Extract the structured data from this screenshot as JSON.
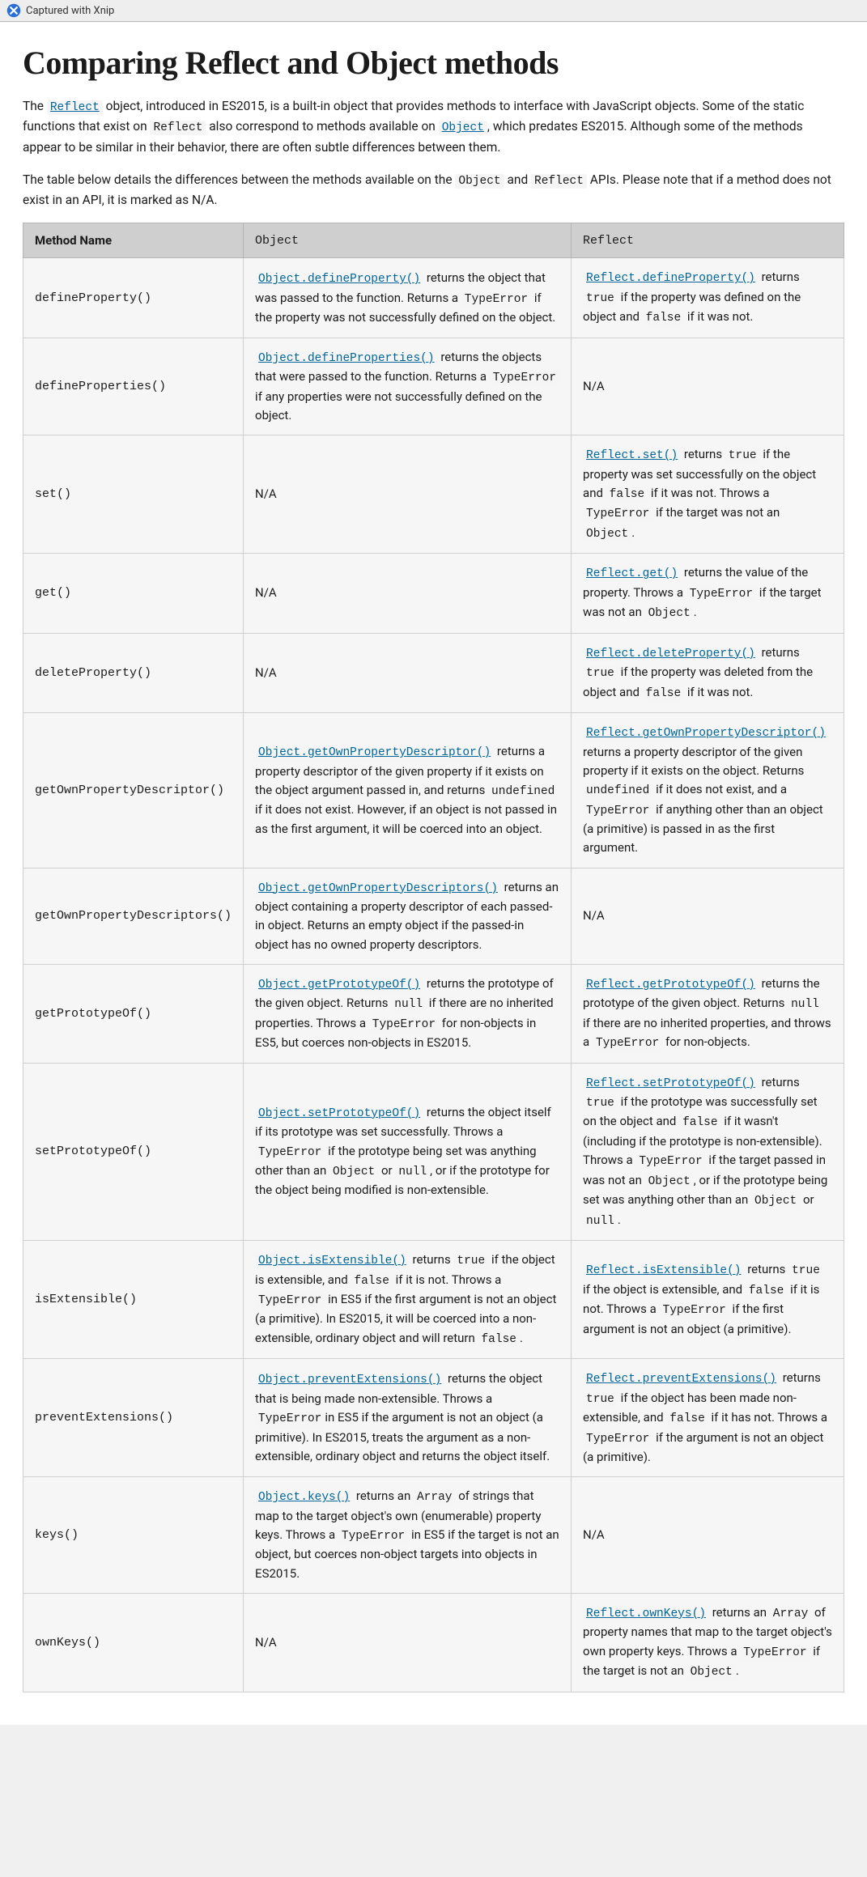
{
  "watermark": {
    "label": "Captured with Xnip"
  },
  "title": "Comparing Reflect and Object methods",
  "intro": {
    "p1_pre": "The ",
    "p1_reflect_link": "Reflect",
    "p1_mid1": " object, introduced in ES2015, is a built-in object that provides methods to interface with JavaScript objects. Some of the static functions that exist on ",
    "p1_reflect_code": "Reflect",
    "p1_mid2": " also correspond to methods available on ",
    "p1_object_link": "Object",
    "p1_tail": ", which predates ES2015. Although some of the methods appear to be similar in their behavior, there are often subtle differences between them.",
    "p2_pre": "The table below details the differences between the methods available on the ",
    "p2_object_code": "Object",
    "p2_and": " and ",
    "p2_reflect_code": "Reflect",
    "p2_tail": " APIs. Please note that if a method does not exist in an API, it is marked as N/A."
  },
  "table": {
    "headers": {
      "name": "Method Name",
      "object": "Object",
      "reflect": "Reflect"
    },
    "na": "N/A",
    "rows": [
      {
        "method": "defineProperty()",
        "object": {
          "segments": [
            {
              "t": "link",
              "v": "Object.defineProperty()"
            },
            {
              "t": "text",
              "v": " returns the object that was passed to the function. Returns a "
            },
            {
              "t": "code",
              "v": "TypeError"
            },
            {
              "t": "text",
              "v": " if the property was not successfully defined on the object."
            }
          ]
        },
        "reflect": {
          "segments": [
            {
              "t": "link",
              "v": "Reflect.defineProperty()"
            },
            {
              "t": "text",
              "v": " returns "
            },
            {
              "t": "code",
              "v": "true"
            },
            {
              "t": "text",
              "v": " if the property was defined on the object and "
            },
            {
              "t": "code",
              "v": "false"
            },
            {
              "t": "text",
              "v": " if it was not."
            }
          ]
        }
      },
      {
        "method": "defineProperties()",
        "object": {
          "segments": [
            {
              "t": "link",
              "v": "Object.defineProperties()"
            },
            {
              "t": "text",
              "v": " returns the objects that were passed to the function. Returns a "
            },
            {
              "t": "code",
              "v": "TypeError"
            },
            {
              "t": "text",
              "v": " if any properties were not successfully defined on the object."
            }
          ]
        },
        "reflect": {
          "na": true
        }
      },
      {
        "method": "set()",
        "object": {
          "na": true
        },
        "reflect": {
          "segments": [
            {
              "t": "link",
              "v": "Reflect.set()"
            },
            {
              "t": "text",
              "v": " returns "
            },
            {
              "t": "code",
              "v": "true"
            },
            {
              "t": "text",
              "v": " if the property was set successfully on the object and "
            },
            {
              "t": "code",
              "v": "false"
            },
            {
              "t": "text",
              "v": " if it was not. Throws a "
            },
            {
              "t": "code",
              "v": "TypeError"
            },
            {
              "t": "text",
              "v": " if the target was not an "
            },
            {
              "t": "code",
              "v": "Object"
            },
            {
              "t": "text",
              "v": "."
            }
          ]
        }
      },
      {
        "method": "get()",
        "object": {
          "na": true
        },
        "reflect": {
          "segments": [
            {
              "t": "link",
              "v": "Reflect.get()"
            },
            {
              "t": "text",
              "v": " returns the value of the property. Throws a "
            },
            {
              "t": "code",
              "v": "TypeError"
            },
            {
              "t": "text",
              "v": " if the target was not an "
            },
            {
              "t": "code",
              "v": "Object"
            },
            {
              "t": "text",
              "v": "."
            }
          ]
        }
      },
      {
        "method": "deleteProperty()",
        "object": {
          "na": true
        },
        "reflect": {
          "segments": [
            {
              "t": "link",
              "v": "Reflect.deleteProperty()"
            },
            {
              "t": "text",
              "v": " returns "
            },
            {
              "t": "code",
              "v": "true"
            },
            {
              "t": "text",
              "v": " if the property was deleted from the object and "
            },
            {
              "t": "code",
              "v": "false"
            },
            {
              "t": "text",
              "v": " if it was not."
            }
          ]
        }
      },
      {
        "method": "getOwnPropertyDescriptor()",
        "object": {
          "segments": [
            {
              "t": "link",
              "v": "Object.getOwnPropertyDescriptor()"
            },
            {
              "t": "text",
              "v": " returns a property descriptor of the given property if it exists on the object argument passed in, and returns "
            },
            {
              "t": "code",
              "v": "undefined"
            },
            {
              "t": "text",
              "v": " if it does not exist. However, if an object is not passed in as the first argument, it will be coerced into an object."
            }
          ]
        },
        "reflect": {
          "segments": [
            {
              "t": "link",
              "v": "Reflect.getOwnPropertyDescriptor()"
            },
            {
              "t": "text",
              "v": " returns a property descriptor of the given property if it exists on the object. Returns "
            },
            {
              "t": "code",
              "v": "undefined"
            },
            {
              "t": "text",
              "v": " if it does not exist, and a "
            },
            {
              "t": "code",
              "v": "TypeError"
            },
            {
              "t": "text",
              "v": " if anything other than an object (a primitive) is passed in as the first argument."
            }
          ]
        }
      },
      {
        "method": "getOwnPropertyDescriptors()",
        "object": {
          "segments": [
            {
              "t": "link",
              "v": "Object.getOwnPropertyDescriptors()"
            },
            {
              "t": "text",
              "v": " returns an object containing a property descriptor of each passed-in object. Returns an empty object if the passed-in object has no owned property descriptors."
            }
          ]
        },
        "reflect": {
          "na": true
        }
      },
      {
        "method": "getPrototypeOf()",
        "object": {
          "segments": [
            {
              "t": "link",
              "v": "Object.getPrototypeOf()"
            },
            {
              "t": "text",
              "v": " returns the prototype of the given object. Returns "
            },
            {
              "t": "code",
              "v": "null"
            },
            {
              "t": "text",
              "v": " if there are no inherited properties. Throws a "
            },
            {
              "t": "code",
              "v": "TypeError"
            },
            {
              "t": "text",
              "v": " for non-objects in ES5, but coerces non-objects in ES2015."
            }
          ]
        },
        "reflect": {
          "segments": [
            {
              "t": "link",
              "v": "Reflect.getPrototypeOf()"
            },
            {
              "t": "text",
              "v": " returns the prototype of the given object. Returns "
            },
            {
              "t": "code",
              "v": "null"
            },
            {
              "t": "text",
              "v": " if there are no inherited properties, and throws a "
            },
            {
              "t": "code",
              "v": "TypeError"
            },
            {
              "t": "text",
              "v": " for non-objects."
            }
          ]
        }
      },
      {
        "method": "setPrototypeOf()",
        "object": {
          "segments": [
            {
              "t": "link",
              "v": "Object.setPrototypeOf()"
            },
            {
              "t": "text",
              "v": " returns the object itself if its prototype was set successfully. Throws a "
            },
            {
              "t": "code",
              "v": "TypeError"
            },
            {
              "t": "text",
              "v": " if the prototype being set was anything other than an "
            },
            {
              "t": "code",
              "v": "Object"
            },
            {
              "t": "text",
              "v": " or "
            },
            {
              "t": "code",
              "v": "null"
            },
            {
              "t": "text",
              "v": ", or if the prototype for the object being modified is non-extensible."
            }
          ]
        },
        "reflect": {
          "segments": [
            {
              "t": "link",
              "v": "Reflect.setPrototypeOf()"
            },
            {
              "t": "text",
              "v": " returns "
            },
            {
              "t": "code",
              "v": "true"
            },
            {
              "t": "text",
              "v": " if the prototype was successfully set on the object and "
            },
            {
              "t": "code",
              "v": "false"
            },
            {
              "t": "text",
              "v": " if it wasn't (including if the prototype is non-extensible). Throws a "
            },
            {
              "t": "code",
              "v": "TypeError"
            },
            {
              "t": "text",
              "v": " if the target passed in was not an "
            },
            {
              "t": "code",
              "v": "Object"
            },
            {
              "t": "text",
              "v": ", or if the prototype being set was anything other than an "
            },
            {
              "t": "code",
              "v": "Object"
            },
            {
              "t": "text",
              "v": " or "
            },
            {
              "t": "code",
              "v": "null"
            },
            {
              "t": "text",
              "v": "."
            }
          ]
        }
      },
      {
        "method": "isExtensible()",
        "object": {
          "segments": [
            {
              "t": "link",
              "v": "Object.isExtensible()"
            },
            {
              "t": "text",
              "v": " returns "
            },
            {
              "t": "code",
              "v": "true"
            },
            {
              "t": "text",
              "v": " if the object is extensible, and "
            },
            {
              "t": "code",
              "v": "false"
            },
            {
              "t": "text",
              "v": " if it is not. Throws a "
            },
            {
              "t": "code",
              "v": "TypeError"
            },
            {
              "t": "text",
              "v": " in ES5 if the first argument is not an object (a primitive). In ES2015, it will be coerced into a non-extensible, ordinary object and will return "
            },
            {
              "t": "code",
              "v": "false"
            },
            {
              "t": "text",
              "v": "."
            }
          ]
        },
        "reflect": {
          "segments": [
            {
              "t": "link",
              "v": "Reflect.isExtensible()"
            },
            {
              "t": "text",
              "v": " returns "
            },
            {
              "t": "code",
              "v": "true"
            },
            {
              "t": "text",
              "v": " if the object is extensible, and "
            },
            {
              "t": "code",
              "v": "false"
            },
            {
              "t": "text",
              "v": " if it is not. Throws a "
            },
            {
              "t": "code",
              "v": "TypeError"
            },
            {
              "t": "text",
              "v": " if the first argument is not an object (a primitive)."
            }
          ]
        }
      },
      {
        "method": "preventExtensions()",
        "object": {
          "segments": [
            {
              "t": "link",
              "v": "Object.preventExtensions()"
            },
            {
              "t": "text",
              "v": " returns the object that is being made non-extensible. Throws a "
            },
            {
              "t": "code",
              "v": "TypeError"
            },
            {
              "t": "text",
              "v": "in ES5 if the argument is not an object (a primitive). In ES2015, treats the argument as a non-extensible, ordinary object and returns the object itself."
            }
          ]
        },
        "reflect": {
          "segments": [
            {
              "t": "link",
              "v": "Reflect.preventExtensions()"
            },
            {
              "t": "text",
              "v": " returns "
            },
            {
              "t": "code",
              "v": "true"
            },
            {
              "t": "text",
              "v": " if the object has been made non-extensible, and "
            },
            {
              "t": "code",
              "v": "false"
            },
            {
              "t": "text",
              "v": " if it has not. Throws a "
            },
            {
              "t": "code",
              "v": "TypeError"
            },
            {
              "t": "text",
              "v": " if the argument is not an object (a primitive)."
            }
          ]
        }
      },
      {
        "method": "keys()",
        "object": {
          "segments": [
            {
              "t": "link",
              "v": "Object.keys()"
            },
            {
              "t": "text",
              "v": " returns an "
            },
            {
              "t": "code",
              "v": "Array"
            },
            {
              "t": "text",
              "v": " of strings that map to the target object's own (enumerable) property keys. Throws a "
            },
            {
              "t": "code",
              "v": "TypeError"
            },
            {
              "t": "text",
              "v": " in ES5 if the target is not an object, but coerces non-object targets into objects in ES2015."
            }
          ]
        },
        "reflect": {
          "na": true
        }
      },
      {
        "method": "ownKeys()",
        "object": {
          "na": true
        },
        "reflect": {
          "segments": [
            {
              "t": "link",
              "v": "Reflect.ownKeys()"
            },
            {
              "t": "text",
              "v": " returns an "
            },
            {
              "t": "code",
              "v": "Array"
            },
            {
              "t": "text",
              "v": " of property names that map to the target object's own property keys. Throws a "
            },
            {
              "t": "code",
              "v": "TypeError"
            },
            {
              "t": "text",
              "v": " if the target is not an "
            },
            {
              "t": "code",
              "v": "Object"
            },
            {
              "t": "text",
              "v": "."
            }
          ]
        }
      }
    ]
  }
}
